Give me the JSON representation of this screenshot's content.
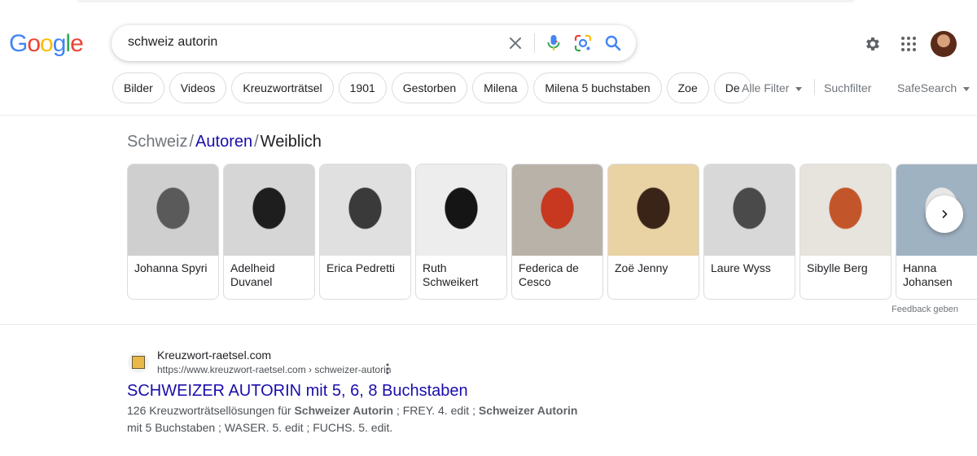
{
  "logo": {
    "letters": [
      "G",
      "o",
      "o",
      "g",
      "l",
      "e"
    ],
    "colors": [
      "#4285F4",
      "#EA4335",
      "#FBBC05",
      "#4285F4",
      "#34A853",
      "#EA4335"
    ]
  },
  "search": {
    "query": "schweiz autorin",
    "icons": [
      "close-icon",
      "microphone-icon",
      "lens-icon",
      "search-icon"
    ]
  },
  "header_icons": [
    "gear-icon",
    "apps-grid-icon",
    "avatar"
  ],
  "chips": [
    "Bilder",
    "Videos",
    "Kreuzworträtsel",
    "1901",
    "Gestorben",
    "Milena",
    "Milena 5 buchstaben",
    "Zoe",
    "De"
  ],
  "filters": {
    "alle_filter": "Alle Filter",
    "suchfilter": "Suchfilter",
    "safesearch": "SafeSearch"
  },
  "breadcrumb": {
    "part0": "Schweiz",
    "sep": "/",
    "part1": "Autoren",
    "part2": "Weiblich"
  },
  "carousel": [
    {
      "name": "Johanna Spyri",
      "tone": [
        "#cfcfcf",
        "#5a5a5a"
      ]
    },
    {
      "name": "Adelheid Duvanel",
      "tone": [
        "#d6d6d6",
        "#1e1e1e"
      ]
    },
    {
      "name": "Erica Pedretti",
      "tone": [
        "#e0e0e0",
        "#3a3a3a"
      ]
    },
    {
      "name": "Ruth Schweikert",
      "tone": [
        "#ededed",
        "#151515"
      ]
    },
    {
      "name": "Federica de Cesco",
      "tone": [
        "#b8b2a8",
        "#c8371f"
      ]
    },
    {
      "name": "Zoë Jenny",
      "tone": [
        "#e9d2a4",
        "#3a2418"
      ]
    },
    {
      "name": "Laure Wyss",
      "tone": [
        "#d8d8d8",
        "#4a4a4a"
      ]
    },
    {
      "name": "Sibylle Berg",
      "tone": [
        "#e7e3dd",
        "#c2562a"
      ]
    },
    {
      "name": "Hanna Johansen",
      "tone": [
        "#9fb2c2",
        "#e8e8e8"
      ]
    }
  ],
  "feedback": "Feedback geben",
  "result": {
    "site": "Kreuzwort-raetsel.com",
    "url": "https://www.kreuzwort-raetsel.com › schweizer-autorin",
    "title": "SCHWEIZER AUTORIN mit 5, 6, 8 Buchstaben",
    "snippet_parts": [
      {
        "t": "126 Kreuzworträtsellösungen für ",
        "b": false
      },
      {
        "t": "Schweizer Autorin",
        "b": true
      },
      {
        "t": " ; FREY. 4. edit ; ",
        "b": false
      },
      {
        "t": "Schweizer Autorin",
        "b": true
      },
      {
        "t": " mit 5 Buchstaben ; WASER. 5. edit ; FUCHS. 5. edit.",
        "b": false
      }
    ]
  }
}
